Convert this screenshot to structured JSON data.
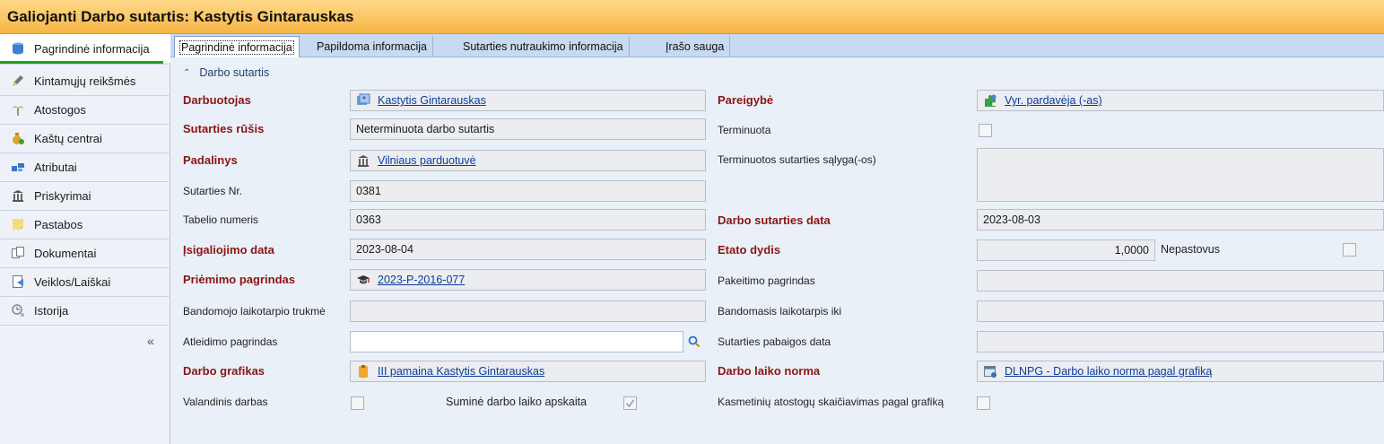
{
  "window": {
    "title": "Galiojanti Darbo sutartis: Kastytis Gintarauskas"
  },
  "sidebar": {
    "items": [
      {
        "label": "Pagrindinė informacija",
        "icon": "database-icon"
      },
      {
        "label": "Kintamųjų reikšmės",
        "icon": "pencil-icon"
      },
      {
        "label": "Atostogos",
        "icon": "palm-icon"
      },
      {
        "label": "Kaštų centrai",
        "icon": "money-bag-icon"
      },
      {
        "label": "Atributai",
        "icon": "blocks-icon"
      },
      {
        "label": "Priskyrimai",
        "icon": "building-icon"
      },
      {
        "label": "Pastabos",
        "icon": "note-icon"
      },
      {
        "label": "Dokumentai",
        "icon": "documents-icon"
      },
      {
        "label": "Veiklos/Laiškai",
        "icon": "mail-icon"
      },
      {
        "label": "Istorija",
        "icon": "history-icon"
      }
    ],
    "collapse_label": "«"
  },
  "tabs": [
    {
      "label": "Pagrindinė informacija"
    },
    {
      "label": "Papildoma informacija"
    },
    {
      "label": "Sutarties nutraukimo informacija"
    },
    {
      "label": "Įrašo sauga"
    }
  ],
  "group": {
    "title": "Darbo sutartis"
  },
  "left_fields": {
    "darbuotojas": {
      "label": "Darbuotojas",
      "value": "Kastytis Gintarauskas"
    },
    "sutarties_rusis": {
      "label": "Sutarties rūšis",
      "value": "Neterminuota darbo sutartis"
    },
    "padalinys": {
      "label": "Padalinys",
      "value": "Vilniaus parduotuvė"
    },
    "sutarties_nr": {
      "label": "Sutarties Nr.",
      "value": "0381"
    },
    "tabelio_numeris": {
      "label": "Tabelio numeris",
      "value": "0363"
    },
    "isigaliojimo_data": {
      "label": "Įsigaliojimo data",
      "value": "2023-08-04"
    },
    "priemimo_pagrindas": {
      "label": "Priėmimo pagrindas",
      "value": "2023-P-2016-077"
    },
    "bandomojo_trukme": {
      "label": "Bandomojo laikotarpio trukmė",
      "value": ""
    },
    "atleidimo_pagrindas": {
      "label": "Atleidimo pagrindas",
      "value": ""
    },
    "darbo_grafikas": {
      "label": "Darbo grafikas",
      "value": "III pamaina Kastytis Gintarauskas"
    },
    "valandinis_darbas": {
      "label": "Valandinis darbas"
    },
    "sumine_apskaita": {
      "label": "Suminė darbo laiko apskaita"
    }
  },
  "right_fields": {
    "pareigybe": {
      "label": "Pareigybė",
      "value": "Vyr. pardavėja (-as)"
    },
    "terminuota": {
      "label": "Terminuota"
    },
    "terminuotos_salyga": {
      "label": "Terminuotos sutarties sąlyga(-os)",
      "value": ""
    },
    "darbo_sutarties_data": {
      "label": "Darbo sutarties data",
      "value": "2023-08-03"
    },
    "etato_dydis": {
      "label": "Etato dydis",
      "value": "1,0000"
    },
    "nepastovus": {
      "label": "Nepastovus"
    },
    "pakeitimo_pagrindas": {
      "label": "Pakeitimo pagrindas",
      "value": ""
    },
    "bandomasis_iki": {
      "label": "Bandomasis laikotarpis iki",
      "value": ""
    },
    "pabaigos_data": {
      "label": "Sutarties pabaigos data",
      "value": ""
    },
    "darbo_laiko_norma": {
      "label": "Darbo laiko norma",
      "value": "DLNPG - Darbo laiko norma pagal grafiką"
    },
    "kasmetiniu_skaiciavimas": {
      "label": "Kasmetinių atostogų skaičiavimas pagal grafiką"
    }
  }
}
